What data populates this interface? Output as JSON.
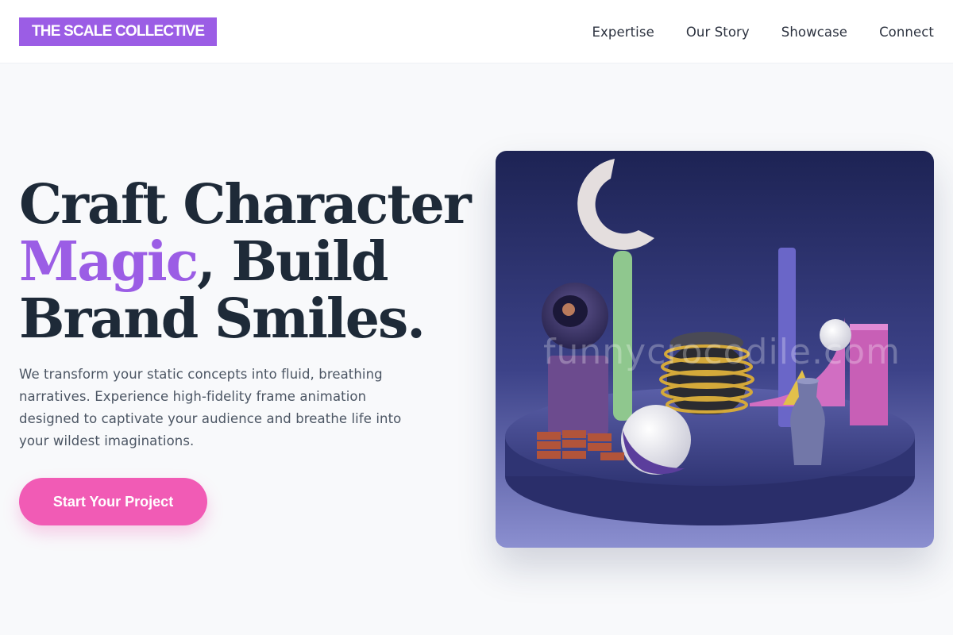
{
  "header": {
    "logo": "THE SCALE COLLECTIVE",
    "nav": [
      "Expertise",
      "Our Story",
      "Showcase",
      "Connect"
    ]
  },
  "hero": {
    "title_part1": "Craft Character",
    "title_accent": "Magic",
    "title_part2": ", Build Brand Smiles.",
    "subtitle": "We transform your static concepts into fluid, breathing narratives. Experience high-fidelity frame animation designed to captivate your audience and breathe life into your wildest imaginations.",
    "cta_label": "Start Your Project",
    "image_watermark": "funnycrocodile.com"
  },
  "colors": {
    "brand": "#9b5de5",
    "cta": "#f15bb5",
    "heading": "#1e2a38",
    "body_text": "#4b5563"
  }
}
